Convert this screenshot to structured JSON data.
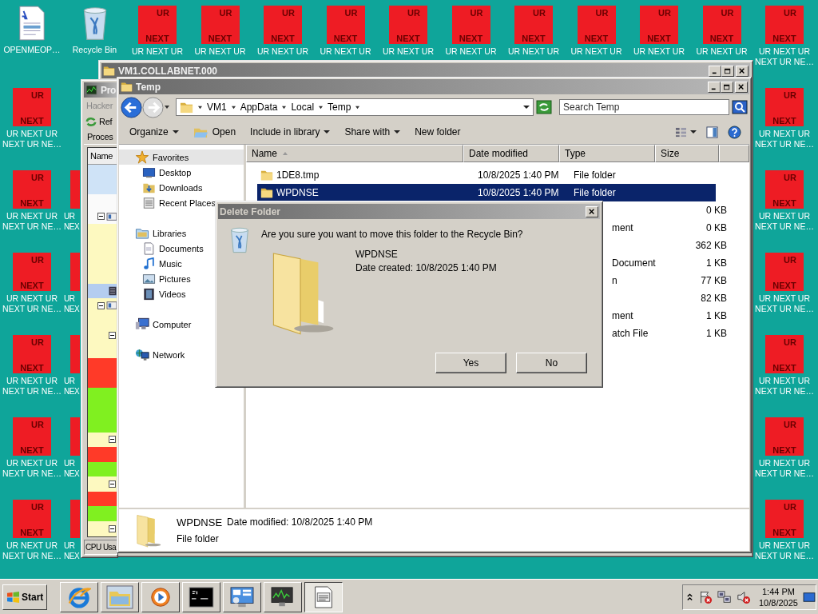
{
  "desktop": {
    "top_icons": [
      {
        "kind": "document",
        "label": "OPENMEOP…"
      },
      {
        "kind": "recycle_bin",
        "label": "Recycle Bin"
      },
      {
        "kind": "tile",
        "tile_top": "UR",
        "tile_bottom": "NEXT",
        "label": "UR NEXT UR"
      },
      {
        "kind": "tile",
        "tile_top": "UR",
        "tile_bottom": "NEXT",
        "label": "UR NEXT UR"
      },
      {
        "kind": "tile",
        "tile_top": "UR",
        "tile_bottom": "NEXT",
        "label": "UR NEXT UR"
      },
      {
        "kind": "tile",
        "tile_top": "UR",
        "tile_bottom": "NEXT",
        "label": "UR NEXT UR"
      },
      {
        "kind": "tile",
        "tile_top": "UR",
        "tile_bottom": "NEXT",
        "label": "UR NEXT UR"
      },
      {
        "kind": "tile",
        "tile_top": "UR",
        "tile_bottom": "NEXT",
        "label": "UR NEXT UR"
      },
      {
        "kind": "tile",
        "tile_top": "UR",
        "tile_bottom": "NEXT",
        "label": "UR NEXT UR"
      },
      {
        "kind": "tile",
        "tile_top": "UR",
        "tile_bottom": "NEXT",
        "label": "UR NEXT UR"
      },
      {
        "kind": "tile",
        "tile_top": "UR",
        "tile_bottom": "NEXT",
        "label": "UR NEXT UR"
      },
      {
        "kind": "tile",
        "tile_top": "UR",
        "tile_bottom": "NEXT",
        "label": "UR NEXT UR"
      },
      {
        "kind": "tile",
        "tile_top": "UR",
        "tile_bottom": "NEXT",
        "label": "UR NEXT UR NEXT UR NE…"
      }
    ],
    "left_icons": [
      {
        "kind": "tile",
        "tile_top": "UR",
        "tile_bottom": "NEXT",
        "label": "UR NEXT UR NEXT UR NE…"
      },
      {
        "kind": "tile",
        "tile_top": "UR",
        "tile_bottom": "NEXT",
        "label": "UR NEXT UR NEXT UR NE…"
      },
      {
        "kind": "tile",
        "tile_top": "UR",
        "tile_bottom": "NEXT",
        "label": "UR NEXT UR NEXT UR NE…"
      },
      {
        "kind": "tile",
        "tile_top": "UR",
        "tile_bottom": "NEXT",
        "label": "UR NEXT UR NEXT UR NE…"
      },
      {
        "kind": "tile",
        "tile_top": "UR",
        "tile_bottom": "NEXT",
        "label": "UR NEXT UR NEXT UR NE…"
      },
      {
        "kind": "tile",
        "tile_top": "UR",
        "tile_bottom": "NEXT",
        "label": "UR NEXT UR NEXT UR NE…"
      }
    ],
    "partial_icons": [
      {
        "label": "UR NEX"
      },
      {
        "label": "UR NEX"
      },
      {
        "label": "UR NEX"
      },
      {
        "label": "UR NEX"
      },
      {
        "label": "UR NEX"
      }
    ],
    "right_icons": [
      {
        "kind": "tile",
        "tile_top": "UR",
        "tile_bottom": "NEXT",
        "label": "UR NEXT UR NEXT UR NE…"
      },
      {
        "kind": "tile",
        "tile_top": "UR",
        "tile_bottom": "NEXT",
        "label": "UR NEXT UR NEXT UR NE…"
      },
      {
        "kind": "tile",
        "tile_top": "UR",
        "tile_bottom": "NEXT",
        "label": "UR NEXT UR NEXT UR NE…"
      },
      {
        "kind": "tile",
        "tile_top": "UR",
        "tile_bottom": "NEXT",
        "label": "UR NEXT UR NEXT UR NE…"
      },
      {
        "kind": "tile",
        "tile_top": "UR",
        "tile_bottom": "NEXT",
        "label": "UR NEXT UR NEXT UR NE…"
      },
      {
        "kind": "tile",
        "tile_top": "UR",
        "tile_bottom": "NEXT",
        "label": "UR NEXT UR NEXT UR NE…"
      }
    ]
  },
  "background_window": {
    "title": "VM1.COLLABNET.000"
  },
  "process_hacker": {
    "title": "Pro",
    "menu": "Hacker",
    "toolbar": "Ref",
    "tab": "Proces",
    "column": "Name",
    "status": "CPU Usa",
    "rows": [
      {
        "kind": "leaf",
        "color": "#cfe3f7"
      },
      {
        "kind": "leaf",
        "color": "#cfe3f7"
      },
      {
        "kind": "leaf",
        "color": "#fafafa"
      },
      {
        "kind": "parent",
        "expanded": true,
        "color": "#fafafa"
      },
      {
        "kind": "leaf",
        "color": "#fdf9c0"
      },
      {
        "kind": "leaf",
        "color": "#fdf9c0"
      },
      {
        "kind": "leaf",
        "color": "#fdf9c0"
      },
      {
        "kind": "leaf",
        "color": "#fdf9c0"
      },
      {
        "kind": "leaf",
        "color": "#b4cdf0"
      },
      {
        "kind": "parent",
        "expanded": true,
        "color": "#fdf9c0"
      },
      {
        "kind": "leaf",
        "color": "#fdf9c0"
      },
      {
        "kind": "parent",
        "expanded": true,
        "color": "#fdf9c0"
      },
      {
        "kind": "leaf",
        "color": "#fdf9c0"
      },
      {
        "kind": "leaf",
        "color": "#ff3a28"
      },
      {
        "kind": "leaf",
        "color": "#ff3a28"
      },
      {
        "kind": "leaf",
        "color": "#80f020"
      },
      {
        "kind": "leaf",
        "color": "#80f020"
      },
      {
        "kind": "leaf",
        "color": "#80f020"
      },
      {
        "kind": "parent",
        "expanded": true,
        "color": "#fdf9c0"
      },
      {
        "kind": "leaf",
        "color": "#ff3a28"
      },
      {
        "kind": "leaf",
        "color": "#80f020"
      },
      {
        "kind": "parent",
        "expanded": true,
        "color": "#fdf9c0"
      },
      {
        "kind": "leaf",
        "color": "#ff3a28"
      },
      {
        "kind": "leaf",
        "color": "#80f020"
      },
      {
        "kind": "parent",
        "expanded": true,
        "color": "#fdf9c0"
      }
    ]
  },
  "explorer": {
    "title": "Temp",
    "breadcrumb": [
      "VM1",
      "AppData",
      "Local",
      "Temp"
    ],
    "search": {
      "placeholder": "Search Temp"
    },
    "toolbar": [
      {
        "kind": "menu",
        "label": "Organize"
      },
      {
        "kind": "icon",
        "label": "Open"
      },
      {
        "kind": "menu",
        "label": "Include in library"
      },
      {
        "kind": "menu",
        "label": "Share with"
      },
      {
        "kind": "plain",
        "label": "New folder"
      }
    ],
    "nav": [
      {
        "kind": "star",
        "label": "Favorites",
        "selected": true,
        "children": [
          {
            "kind": "desktop",
            "label": "Desktop",
            "selected": false
          },
          {
            "kind": "downloads",
            "label": "Downloads",
            "selected": false
          },
          {
            "kind": "recent",
            "label": "Recent Places",
            "selected": false
          }
        ]
      },
      {
        "kind": "libraries",
        "label": "Libraries",
        "selected": false,
        "children": [
          {
            "kind": "documents",
            "label": "Documents",
            "selected": false
          },
          {
            "kind": "music",
            "label": "Music",
            "selected": false
          },
          {
            "kind": "pictures",
            "label": "Pictures",
            "selected": false
          },
          {
            "kind": "videos",
            "label": "Videos",
            "selected": false
          }
        ]
      },
      {
        "kind": "computer",
        "label": "Computer",
        "selected": false
      },
      {
        "kind": "network",
        "label": "Network",
        "selected": false
      }
    ],
    "columns": [
      "Name",
      "Date modified",
      "Type",
      "Size"
    ],
    "rows": [
      {
        "kind": "full",
        "name": "1DE8.tmp",
        "date": "10/8/2025 1:40 PM",
        "type": "File folder",
        "selected": false
      },
      {
        "kind": "full",
        "name": "WPDNSE",
        "date": "10/8/2025 1:40 PM",
        "type": "File folder",
        "selected": true
      },
      {
        "kind": "covered",
        "size": "0 KB",
        "selected": false
      },
      {
        "kind": "covered",
        "type": "ment",
        "size": "0 KB",
        "selected": false
      },
      {
        "kind": "covered",
        "size": "362 KB",
        "selected": false
      },
      {
        "kind": "covered",
        "type": "Document",
        "size": "1 KB",
        "selected": false
      },
      {
        "kind": "covered",
        "type": "n",
        "size": "77 KB",
        "selected": false
      },
      {
        "kind": "covered",
        "size": "82 KB",
        "selected": false
      },
      {
        "kind": "covered",
        "type": "ment",
        "size": "1 KB",
        "selected": false
      },
      {
        "kind": "covered",
        "type": "atch File",
        "size": "1 KB",
        "selected": false
      }
    ],
    "details": {
      "name": "WPDNSE",
      "modified": "Date modified: 10/8/2025 1:40 PM",
      "type": "File folder"
    }
  },
  "dialog": {
    "title": "Delete Folder",
    "question": "Are you sure you want to move this folder to the Recycle Bin?",
    "item_name": "WPDNSE",
    "item_date": "Date created: 10/8/2025 1:40 PM",
    "buttons": [
      "Yes",
      "No"
    ]
  },
  "taskbar": {
    "start": "Start",
    "apps": [
      {
        "kind": "browser",
        "selected": false
      },
      {
        "kind": "folder",
        "selected": false
      },
      {
        "kind": "media",
        "selected": false
      },
      {
        "kind": "console",
        "selected": false
      },
      {
        "kind": "control_panel",
        "selected": false
      },
      {
        "kind": "monitor",
        "selected": false
      },
      {
        "kind": "notepad",
        "selected": true
      }
    ],
    "time": "1:44 PM",
    "date": "10/8/2025"
  }
}
